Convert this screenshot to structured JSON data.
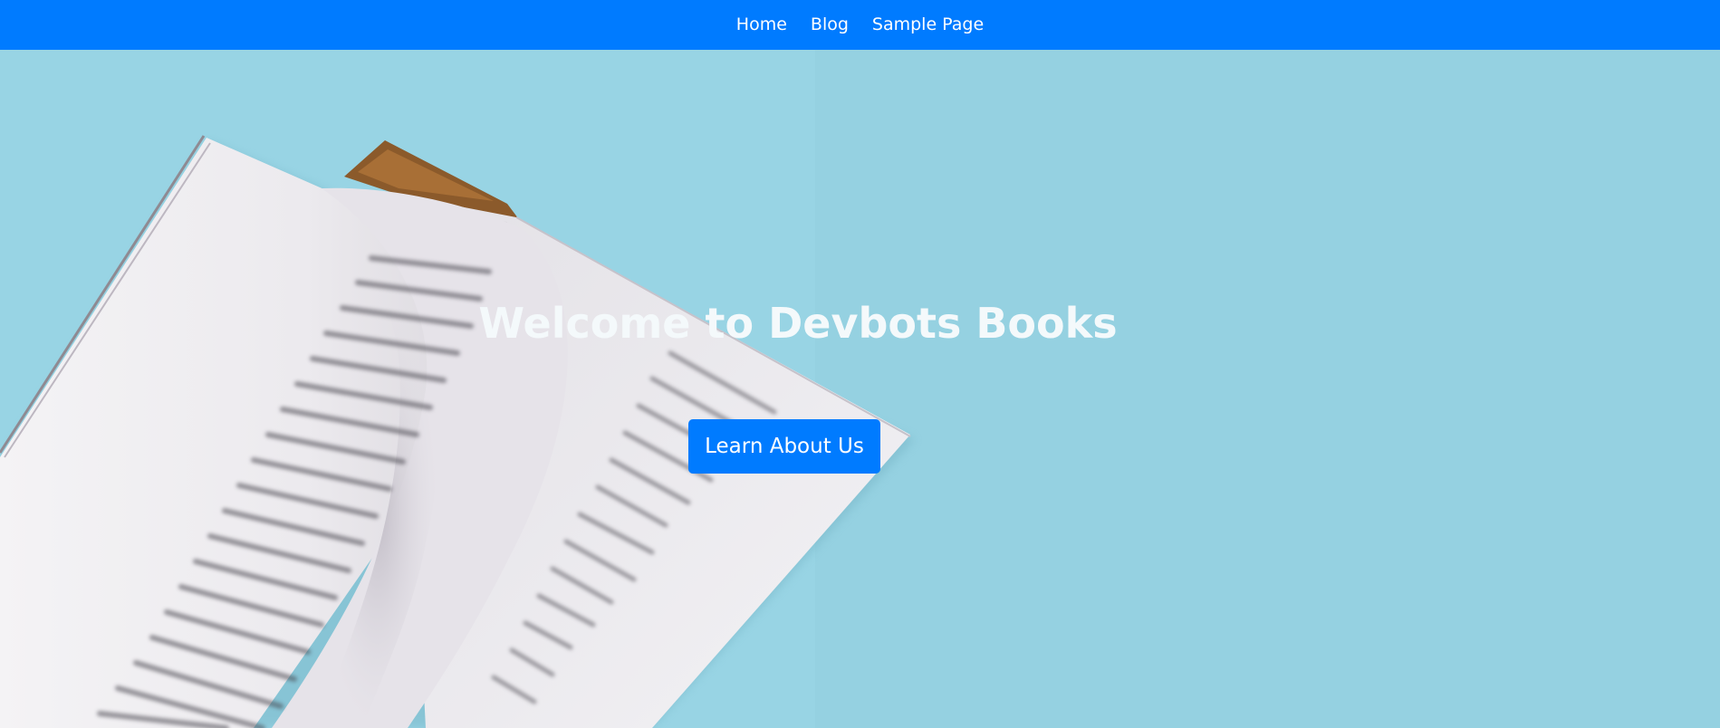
{
  "nav": {
    "items": [
      {
        "label": "Home"
      },
      {
        "label": "Blog"
      },
      {
        "label": "Sample Page"
      }
    ]
  },
  "hero": {
    "title": "Welcome to Devbots Books",
    "cta_label": "Learn About Us"
  },
  "colors": {
    "brand": "#007bff",
    "background": "#96d3e3"
  }
}
